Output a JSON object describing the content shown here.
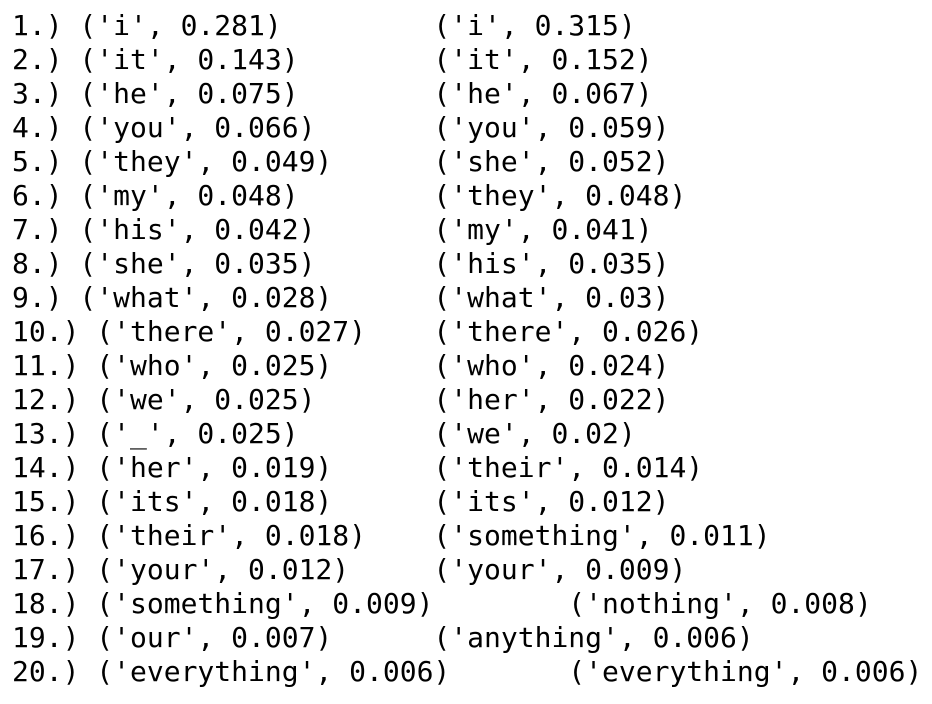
{
  "lines": [
    "1.) ('i', 0.281)         ('i', 0.315)",
    "2.) ('it', 0.143)        ('it', 0.152)",
    "3.) ('he', 0.075)        ('he', 0.067)",
    "4.) ('you', 0.066)       ('you', 0.059)",
    "5.) ('they', 0.049)      ('she', 0.052)",
    "6.) ('my', 0.048)        ('they', 0.048)",
    "7.) ('his', 0.042)       ('my', 0.041)",
    "8.) ('she', 0.035)       ('his', 0.035)",
    "9.) ('what', 0.028)      ('what', 0.03)",
    "10.) ('there', 0.027)    ('there', 0.026)",
    "11.) ('who', 0.025)      ('who', 0.024)",
    "12.) ('we', 0.025)       ('her', 0.022)",
    "13.) ('_', 0.025)        ('we', 0.02)",
    "14.) ('her', 0.019)      ('their', 0.014)",
    "15.) ('its', 0.018)      ('its', 0.012)",
    "16.) ('their', 0.018)    ('something', 0.011)",
    "17.) ('your', 0.012)     ('your', 0.009)",
    "18.) ('something', 0.009)        ('nothing', 0.008)",
    "19.) ('our', 0.007)      ('anything', 0.006)",
    "20.) ('everything', 0.006)       ('everything', 0.006)"
  ]
}
